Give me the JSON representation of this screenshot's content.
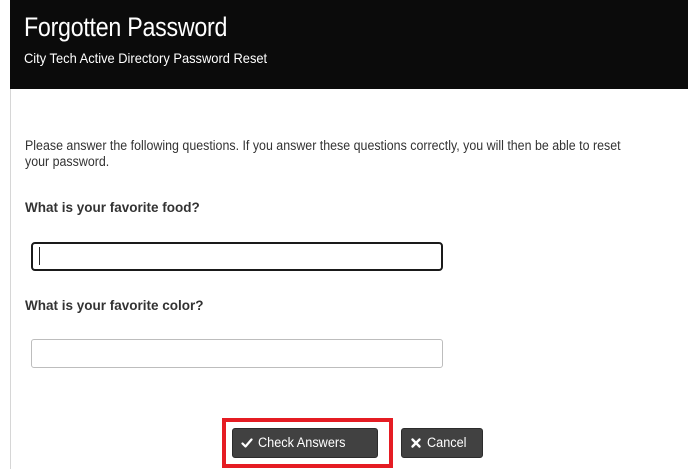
{
  "header": {
    "title": "Forgotten Password",
    "subtitle": "City Tech Active Directory Password Reset"
  },
  "form": {
    "intro": "Please answer the following questions. If you answer these questions correctly, you will then be able to reset your password.",
    "questions": [
      {
        "label": "What is your favorite food?",
        "value": ""
      },
      {
        "label": "What is your favorite color?",
        "value": ""
      }
    ]
  },
  "actions": {
    "check_label": "Check Answers",
    "check_icon": "checkmark-icon",
    "cancel_label": "Cancel",
    "cancel_icon": "x-icon",
    "highlight_color": "#e51c23"
  },
  "colors": {
    "header_bg": "#0b0b0b",
    "button_bg": "#414141"
  }
}
